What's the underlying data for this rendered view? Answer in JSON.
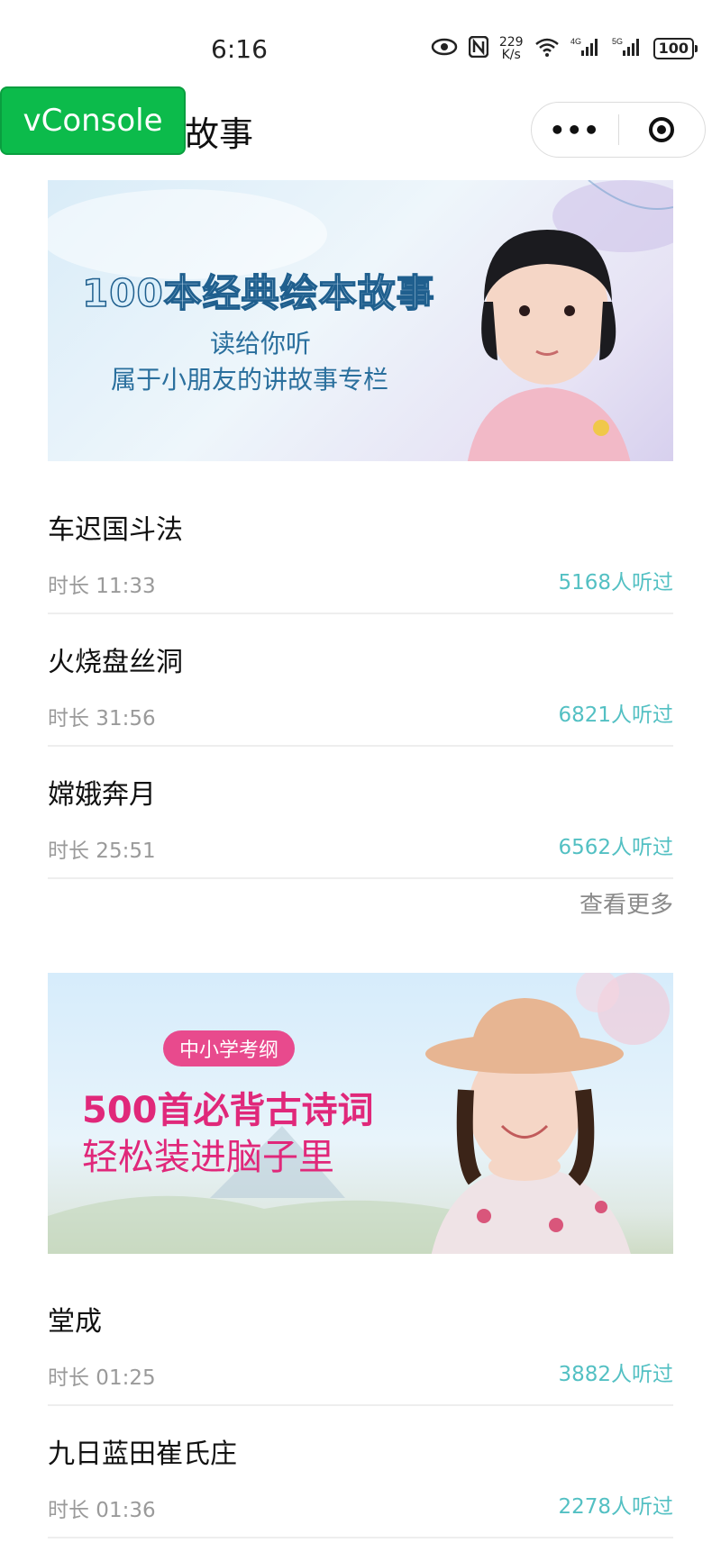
{
  "status_bar": {
    "time": "6:16",
    "net_speed_value": "229",
    "net_speed_unit": "K/s",
    "signal_4g": "4G",
    "signal_5g": "5G",
    "battery": "100"
  },
  "nav": {
    "title_visible": "故事",
    "vconsole_label": "vConsole",
    "more_label": "•••"
  },
  "colors": {
    "accent_teal": "#53c0c3",
    "vconsole_green": "#0cbb4b",
    "banner2_pink": "#e0287a"
  },
  "sections": [
    {
      "banner": {
        "title": "100本经典绘本故事",
        "subtitle_1": "读给你听",
        "subtitle_2": "属于小朋友的讲故事专栏"
      },
      "items": [
        {
          "title": "车迟国斗法",
          "duration": "时长 11:33",
          "listens": "5168人听过"
        },
        {
          "title": "火烧盘丝洞",
          "duration": "时长 31:56",
          "listens": "6821人听过"
        },
        {
          "title": "嫦娥奔月",
          "duration": "时长 25:51",
          "listens": "6562人听过"
        }
      ],
      "more_label": "查看更多"
    },
    {
      "banner": {
        "badge": "中小学考纲",
        "title": "500首必背古诗词",
        "subtitle": "轻松装进脑子里"
      },
      "items": [
        {
          "title": "堂成",
          "duration": "时长 01:25",
          "listens": "3882人听过"
        },
        {
          "title": "九日蓝田崔氏庄",
          "duration": "时长 01:36",
          "listens": "2278人听过"
        }
      ]
    }
  ]
}
